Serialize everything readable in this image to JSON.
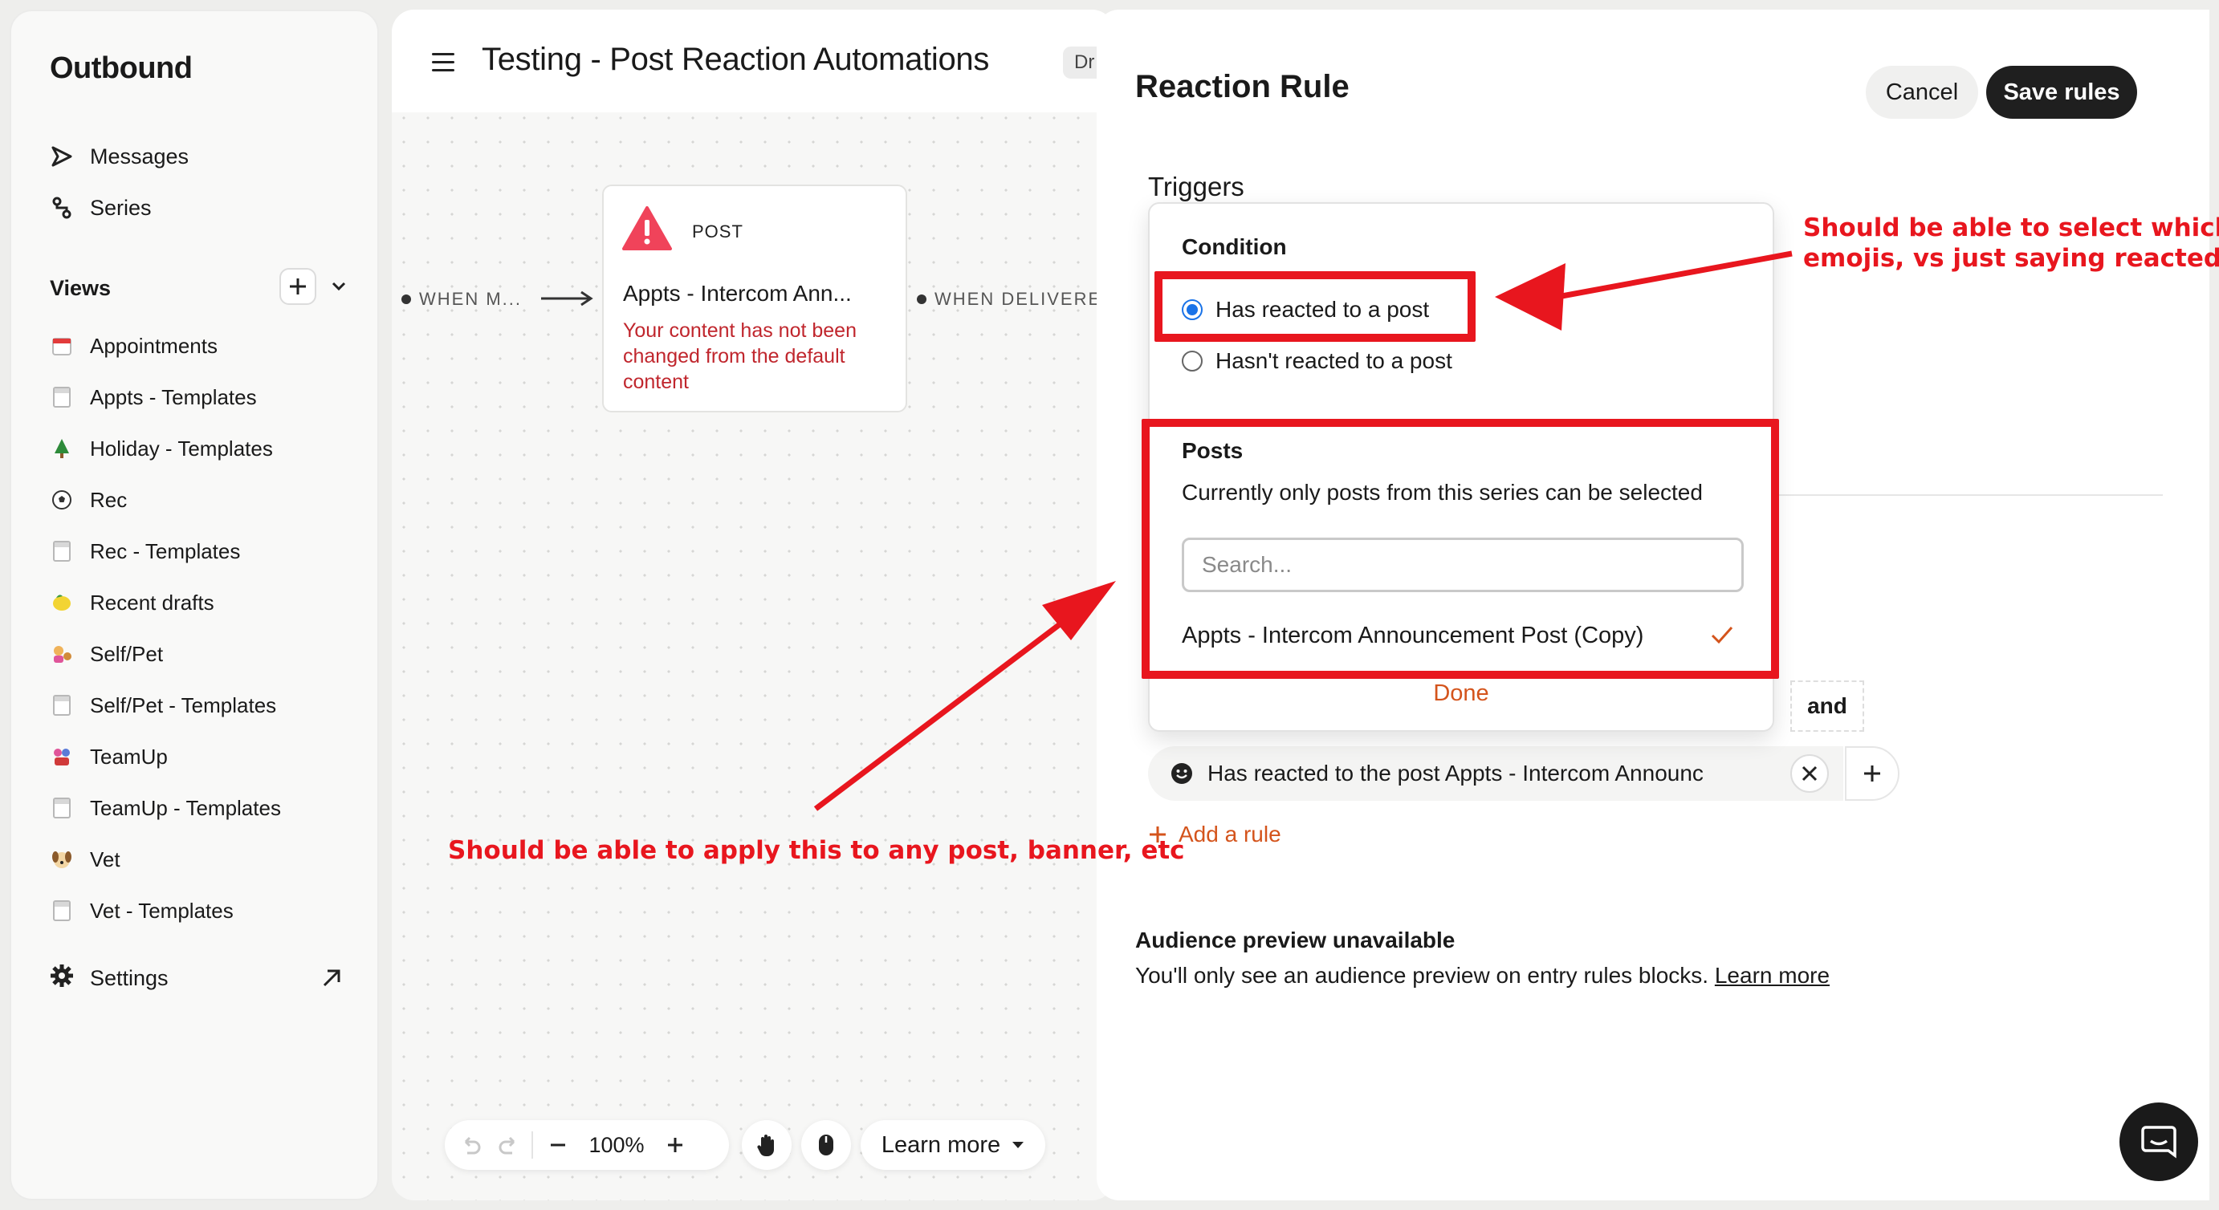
{
  "sidebar": {
    "title": "Outbound",
    "nav": [
      {
        "label": "Messages",
        "icon": "send-icon"
      },
      {
        "label": "Series",
        "icon": "series-icon"
      }
    ],
    "views_label": "Views",
    "views": [
      {
        "label": "Appointments",
        "icon": "calendar-icon"
      },
      {
        "label": "Appts - Templates",
        "icon": "template-icon"
      },
      {
        "label": "Holiday - Templates",
        "icon": "tree-icon"
      },
      {
        "label": "Rec",
        "icon": "soccer-ball-icon"
      },
      {
        "label": "Rec - Templates",
        "icon": "template-icon"
      },
      {
        "label": "Recent drafts",
        "icon": "lemon-icon"
      },
      {
        "label": "Self/Pet",
        "icon": "person-pet-icon"
      },
      {
        "label": "Self/Pet - Templates",
        "icon": "template-icon"
      },
      {
        "label": "TeamUp",
        "icon": "team-icon"
      },
      {
        "label": "TeamUp - Templates",
        "icon": "template-icon"
      },
      {
        "label": "Vet",
        "icon": "dog-icon"
      },
      {
        "label": "Vet - Templates",
        "icon": "template-icon"
      }
    ],
    "settings_label": "Settings"
  },
  "canvas": {
    "title": "Testing - Post Reaction Automations",
    "status_badge": "Dr",
    "when_left": "WHEN M...",
    "when_right": "WHEN DELIVERE",
    "post_card": {
      "kind": "POST",
      "name": "Appts - Intercom Ann...",
      "warning": "Your content has not been changed from the default content"
    },
    "toolbar": {
      "zoom": "100%",
      "learn_more": "Learn more"
    }
  },
  "panel": {
    "title": "Reaction Rule",
    "cancel": "Cancel",
    "save": "Save rules",
    "triggers": "Triggers",
    "condition_label": "Condition",
    "conditions": [
      {
        "label": "Has reacted to a post",
        "selected": true
      },
      {
        "label": "Hasn't reacted to a post",
        "selected": false
      }
    ],
    "posts_label": "Posts",
    "posts_sub": "Currently only posts from this series can be selected",
    "search_placeholder": "Search...",
    "post_option": "Appts - Intercom Announcement Post (Copy)",
    "done": "Done",
    "and_label": "and",
    "rule_text": "Has reacted to the post Appts - Intercom Announc",
    "add_rule": "Add a rule",
    "audience_title": "Audience preview unavailable",
    "audience_text": "You'll only see an audience preview on entry rules blocks.",
    "audience_link": "Learn more"
  },
  "annotations": {
    "top_right_line1": "Should be able to select which",
    "top_right_line2": "emojis, vs just saying reacted to",
    "bottom_left": "Should be able to apply this to any post, banner, etc",
    "color": "#e8161e"
  },
  "colors": {
    "accent_orange": "#d4541c",
    "warning_red": "#c0262d",
    "radio_blue": "#1a73e8",
    "dark": "#1f1f1f"
  }
}
